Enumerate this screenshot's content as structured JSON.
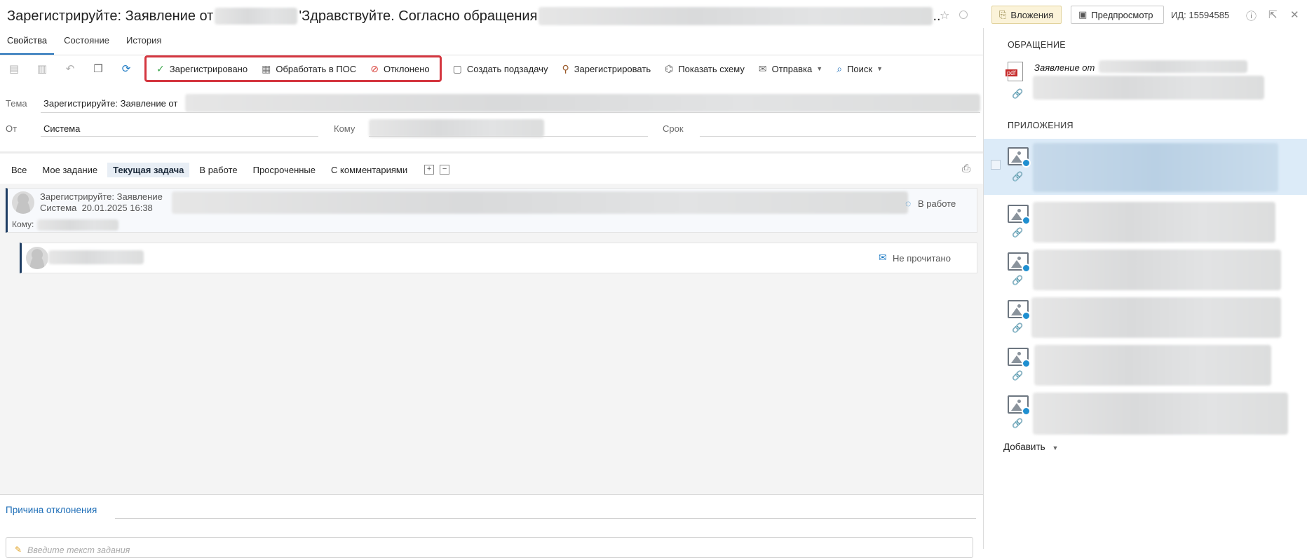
{
  "header": {
    "title_part1": "Зарегистрируйте: Заявление от",
    "title_part2": "'Здравствуйте. Согласно обращения",
    "title_ellipsis": "..",
    "attachments_label": "Вложения",
    "preview_label": "Предпросмотр",
    "id_label": "ИД: 15594585"
  },
  "tabs": [
    {
      "label": "Свойства",
      "active": true
    },
    {
      "label": "Состояние",
      "active": false
    },
    {
      "label": "История",
      "active": false
    }
  ],
  "toolbar": {
    "registered_label": "Зарегистрировано",
    "process_label": "Обработать в ПОС",
    "rejected_label": "Отклонено",
    "create_subtask_label": "Создать подзадачу",
    "register_label": "Зарегистрировать",
    "show_scheme_label": "Показать схему",
    "send_label": "Отправка",
    "search_label": "Поиск"
  },
  "form": {
    "subject_label": "Тема",
    "subject_value": "Зарегистрируйте: Заявление от",
    "from_label": "От",
    "from_value": "Система",
    "to_label": "Кому",
    "deadline_label": "Срок"
  },
  "filters": [
    {
      "label": "Все",
      "active": false
    },
    {
      "label": "Мое задание",
      "active": false
    },
    {
      "label": "Текущая задача",
      "active": true
    },
    {
      "label": "В работе",
      "active": false
    },
    {
      "label": "Просроченные",
      "active": false
    },
    {
      "label": "С комментариями",
      "active": false
    }
  ],
  "tasks": {
    "main_title": "Зарегистрируйте: Заявление",
    "main_meta": "Система  20.01.2025 16:38",
    "main_to_label": "Кому:",
    "main_status": "В работе",
    "sub_status": "Не прочитано"
  },
  "bottom": {
    "reject_reason_label": "Причина отклонения",
    "task_text_placeholder": "Введите текст задания"
  },
  "right_panel": {
    "request_section": "ОБРАЩЕНИЕ",
    "request_doc_name": "Заявление от",
    "request_doc_icon": "pdf",
    "attachments_section": "ПРИЛОЖЕНИЯ",
    "add_label": "Добавить"
  },
  "colors": {
    "accent": "#1f6fb8",
    "highlight_border": "#d4363f",
    "selected_row": "#dcebf8"
  }
}
